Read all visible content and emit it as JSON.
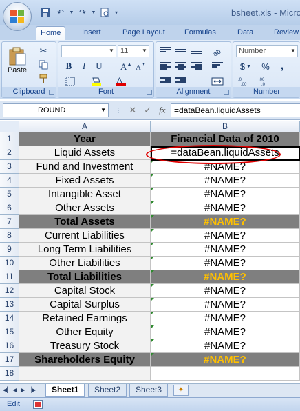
{
  "window": {
    "title": "bsheet.xls - Micro"
  },
  "qat": {
    "icons": [
      "save-icon",
      "undo-icon",
      "redo-icon",
      "print-preview-icon",
      "customize-icon"
    ]
  },
  "ribbon": {
    "tabs": [
      "Home",
      "Insert",
      "Page Layout",
      "Formulas",
      "Data",
      "Review"
    ],
    "active_tab": "Home",
    "clipboard": {
      "label": "Clipboard",
      "paste_label": "Paste"
    },
    "font": {
      "label": "Font",
      "font_size": "11",
      "bold": "B",
      "italic": "I",
      "underline": "U"
    },
    "alignment": {
      "label": "Alignment"
    },
    "number": {
      "label": "Number",
      "format": "Number",
      "currency": "$",
      "percent": "%",
      "comma": ","
    }
  },
  "formula_bar": {
    "name_box": "ROUND",
    "fx": "fx",
    "cancel": "✕",
    "enter": "✓",
    "formula": "=dataBean.liquidAssets"
  },
  "grid": {
    "columns": [
      "A",
      "B"
    ],
    "rows": [
      {
        "num": "1",
        "a": "Year",
        "b": "Financial Data of 2010",
        "style": "dark"
      },
      {
        "num": "2",
        "a": "Liquid Assets",
        "b": "=dataBean.liquidAssets",
        "style": "normal"
      },
      {
        "num": "3",
        "a": "Fund and Investment",
        "b": "#NAME?",
        "style": "normal"
      },
      {
        "num": "4",
        "a": "Fixed Assets",
        "b": "#NAME?",
        "style": "normal"
      },
      {
        "num": "5",
        "a": "Intangible Asset",
        "b": "#NAME?",
        "style": "normal"
      },
      {
        "num": "6",
        "a": "Other Assets",
        "b": "#NAME?",
        "style": "normal"
      },
      {
        "num": "7",
        "a": "Total Assets",
        "b": "#NAME?",
        "style": "total"
      },
      {
        "num": "8",
        "a": "Current Liabilities",
        "b": "#NAME?",
        "style": "normal"
      },
      {
        "num": "9",
        "a": "Long Term Liabilities",
        "b": "#NAME?",
        "style": "normal"
      },
      {
        "num": "10",
        "a": "Other Liabilities",
        "b": "#NAME?",
        "style": "normal"
      },
      {
        "num": "11",
        "a": "Total Liabilities",
        "b": "#NAME?",
        "style": "total"
      },
      {
        "num": "12",
        "a": "Capital Stock",
        "b": "#NAME?",
        "style": "normal"
      },
      {
        "num": "13",
        "a": "Capital Surplus",
        "b": "#NAME?",
        "style": "normal"
      },
      {
        "num": "14",
        "a": "Retained Earnings",
        "b": "#NAME?",
        "style": "normal"
      },
      {
        "num": "15",
        "a": "Other Equity",
        "b": "#NAME?",
        "style": "normal"
      },
      {
        "num": "16",
        "a": "Treasury Stock",
        "b": "#NAME?",
        "style": "normal"
      },
      {
        "num": "17",
        "a": "Shareholders Equity",
        "b": "#NAME?",
        "style": "total"
      },
      {
        "num": "18",
        "a": "",
        "b": "",
        "style": "blank"
      }
    ],
    "colors": {
      "header_fill": "#7f7f7f",
      "total_value": "#ffc000",
      "highlight_ring": "#e00000"
    }
  },
  "sheets": {
    "tabs": [
      "Sheet1",
      "Sheet2",
      "Sheet3"
    ],
    "active": "Sheet1"
  },
  "status": {
    "mode": "Edit"
  }
}
